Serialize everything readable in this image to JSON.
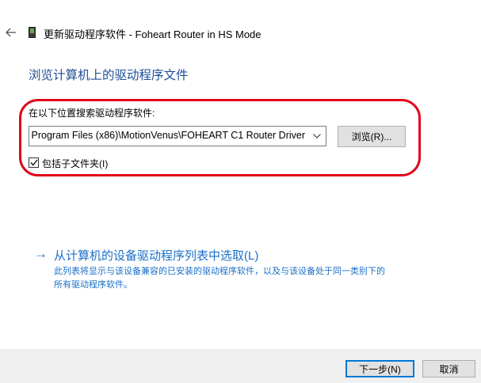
{
  "header": {
    "title": "更新驱动程序软件 - Foheart Router in HS Mode",
    "back_icon": "back-arrow-icon",
    "device_icon": "device-icon"
  },
  "main": {
    "page_title": "浏览计算机上的驱动程序文件",
    "search_label": "在以下位置搜索驱动程序软件:",
    "path_value": "Program Files (x86)\\MotionVenus\\FOHEART C1 Router Driver",
    "browse_label": "浏览(R)...",
    "include_subfolders_label": "包括子文件夹(I)",
    "include_subfolders_checked": true,
    "pick_link": "从计算机的设备驱动程序列表中选取(L)",
    "pick_desc_line1": "此列表将显示与该设备兼容的已安装的驱动程序软件，以及与该设备处于同一类别下的",
    "pick_desc_line2": "所有驱动程序软件。"
  },
  "footer": {
    "next_label": "下一步(N)",
    "cancel_label": "取消"
  },
  "colors": {
    "title_blue": "#1f4e96",
    "link_blue": "#1a6fc8",
    "highlight_red": "#e0061b",
    "footer_bg": "#f0f0f0"
  }
}
